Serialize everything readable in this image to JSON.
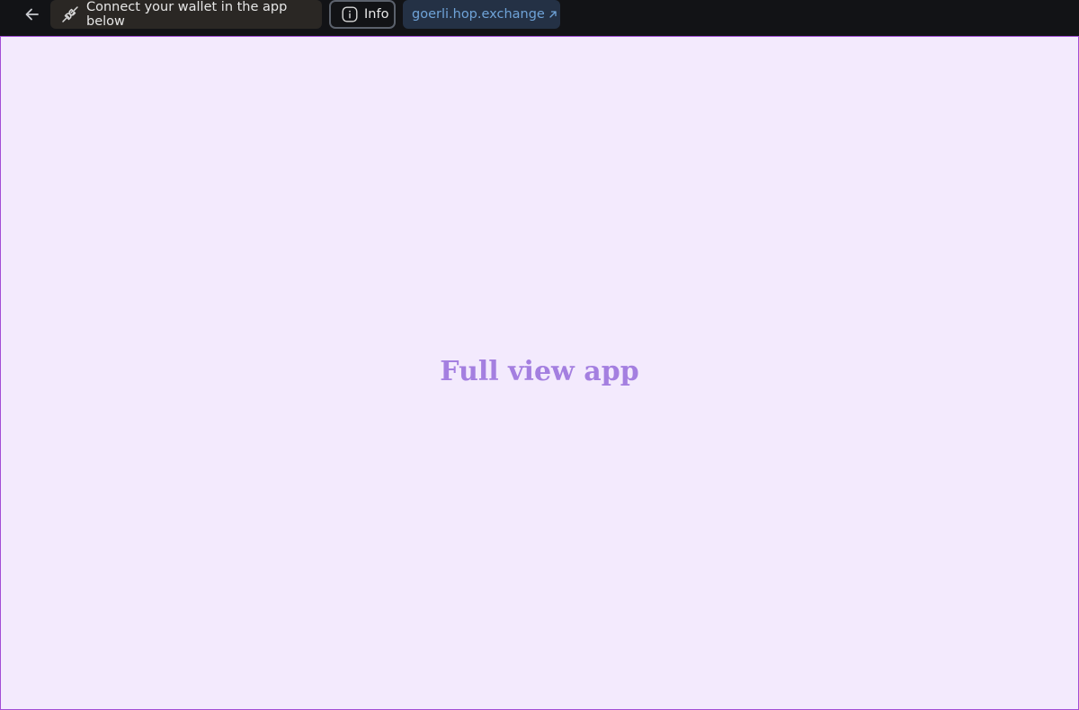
{
  "toolbar": {
    "back_icon": "arrow-left-icon",
    "wallet_notice": {
      "icon": "plug-icon",
      "text": "Connect your wallet in the app below"
    },
    "info_button": {
      "icon": "info-icon",
      "label": "Info"
    },
    "external_link": {
      "label": "goerli.hop.exchange",
      "icon": "external-link-icon"
    }
  },
  "app_frame": {
    "placeholder": "Full view app"
  },
  "colors": {
    "topbar_bg": "#121316",
    "frame_bg": "#f3eafd",
    "frame_border": "#a24ed6",
    "placeholder_text": "#a47fe0",
    "link_text": "#6fa3d8"
  }
}
